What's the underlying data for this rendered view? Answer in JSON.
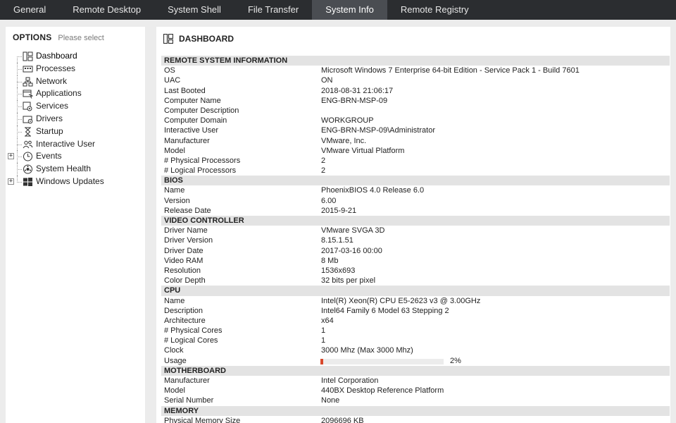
{
  "tabs": [
    {
      "label": "General",
      "active": false
    },
    {
      "label": "Remote Desktop",
      "active": false
    },
    {
      "label": "System Shell",
      "active": false
    },
    {
      "label": "File Transfer",
      "active": false
    },
    {
      "label": "System Info",
      "active": true
    },
    {
      "label": "Remote Registry",
      "active": false
    }
  ],
  "options": {
    "title": "OPTIONS",
    "hint": "Please select",
    "items": [
      {
        "label": "Dashboard",
        "icon": "dashboard-icon",
        "expandable": false,
        "selected": true
      },
      {
        "label": "Processes",
        "icon": "processes-icon",
        "expandable": false
      },
      {
        "label": "Network",
        "icon": "network-icon",
        "expandable": false
      },
      {
        "label": "Applications",
        "icon": "applications-icon",
        "expandable": false
      },
      {
        "label": "Services",
        "icon": "services-icon",
        "expandable": false
      },
      {
        "label": "Drivers",
        "icon": "drivers-icon",
        "expandable": false
      },
      {
        "label": "Startup",
        "icon": "startup-icon",
        "expandable": false
      },
      {
        "label": "Interactive User",
        "icon": "users-icon",
        "expandable": false
      },
      {
        "label": "Events",
        "icon": "events-icon",
        "expandable": true
      },
      {
        "label": "System Health",
        "icon": "system-health-icon",
        "expandable": false
      },
      {
        "label": "Windows Updates",
        "icon": "windows-icon",
        "expandable": true
      }
    ]
  },
  "dashboard": {
    "title": "DASHBOARD",
    "sections": [
      {
        "title": "REMOTE SYSTEM INFORMATION",
        "rows": [
          {
            "key": "OS",
            "value": "Microsoft Windows 7 Enterprise  64-bit Edition - Service Pack 1 - Build 7601"
          },
          {
            "key": "UAC",
            "value": "ON"
          },
          {
            "key": "Last Booted",
            "value": "2018-08-31 21:06:17"
          },
          {
            "key": "Computer Name",
            "value": "ENG-BRN-MSP-09"
          },
          {
            "key": "Computer Description",
            "value": ""
          },
          {
            "key": "Computer Domain",
            "value": "WORKGROUP"
          },
          {
            "key": "Interactive User",
            "value": "ENG-BRN-MSP-09\\Administrator"
          },
          {
            "key": "Manufacturer",
            "value": "VMware, Inc."
          },
          {
            "key": "Model",
            "value": "VMware Virtual Platform"
          },
          {
            "key": "# Physical Processors",
            "value": "2"
          },
          {
            "key": "# Logical Processors",
            "value": "2"
          }
        ]
      },
      {
        "title": "BIOS",
        "rows": [
          {
            "key": "Name",
            "value": "PhoenixBIOS 4.0 Release 6.0"
          },
          {
            "key": "Version",
            "value": "6.00"
          },
          {
            "key": "Release Date",
            "value": "2015-9-21"
          }
        ]
      },
      {
        "title": "VIDEO CONTROLLER",
        "rows": [
          {
            "key": "Driver Name",
            "value": "VMware SVGA 3D"
          },
          {
            "key": "Driver Version",
            "value": "8.15.1.51"
          },
          {
            "key": "Driver Date",
            "value": "2017-03-16 00:00"
          },
          {
            "key": "Video RAM",
            "value": "8 Mb"
          },
          {
            "key": "Resolution",
            "value": "1536x693"
          },
          {
            "key": "Color Depth",
            "value": "32 bits per pixel"
          }
        ]
      },
      {
        "title": "CPU",
        "rows": [
          {
            "key": "Name",
            "value": "Intel(R) Xeon(R) CPU E5-2623 v3 @ 3.00GHz"
          },
          {
            "key": "Description",
            "value": "Intel64 Family 6 Model 63 Stepping 2"
          },
          {
            "key": "Architecture",
            "value": "x64"
          },
          {
            "key": "# Physical Cores",
            "value": "1"
          },
          {
            "key": "# Logical Cores",
            "value": "1"
          },
          {
            "key": "Clock",
            "value": "3000 Mhz (Max 3000 Mhz)"
          },
          {
            "key": "Usage",
            "value": "2%",
            "progress": 0.02
          }
        ]
      },
      {
        "title": "MOTHERBOARD",
        "rows": [
          {
            "key": "Manufacturer",
            "value": "Intel Corporation"
          },
          {
            "key": "Model",
            "value": "440BX Desktop Reference Platform"
          },
          {
            "key": "Serial Number",
            "value": "None"
          }
        ]
      },
      {
        "title": "MEMORY",
        "rows": [
          {
            "key": "Physical Memory Size",
            "value": "2096696 KB"
          }
        ]
      }
    ]
  },
  "colors": {
    "tabbar_bg": "#2b2d30",
    "tab_active_bg": "#4a4d52",
    "section_header_bg": "#e3e3e3",
    "usage_bar": "#d9492c"
  }
}
